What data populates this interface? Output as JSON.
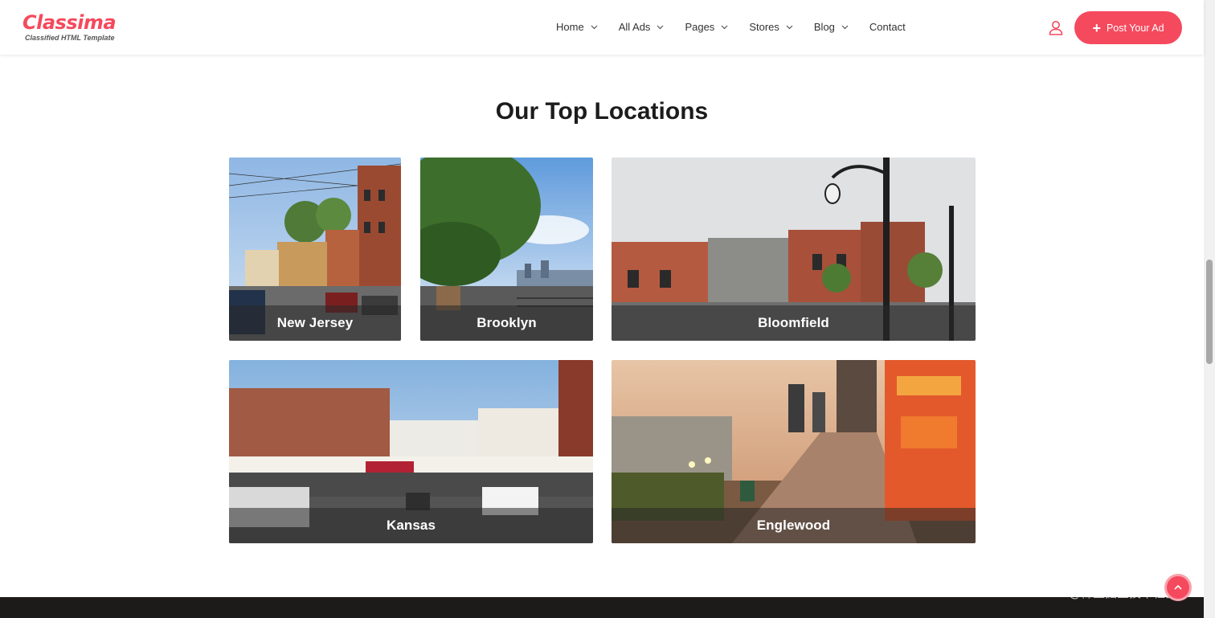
{
  "brand": {
    "name": "Classima",
    "tagline": "Classified HTML Template",
    "accent": "#f5495d"
  },
  "nav": {
    "items": [
      {
        "label": "Home",
        "dropdown": true
      },
      {
        "label": "All Ads",
        "dropdown": true
      },
      {
        "label": "Pages",
        "dropdown": true
      },
      {
        "label": "Stores",
        "dropdown": true
      },
      {
        "label": "Blog",
        "dropdown": true
      },
      {
        "label": "Contact",
        "dropdown": false
      }
    ],
    "post_button": "Post Your Ad",
    "user_icon": "user-icon"
  },
  "section": {
    "title": "Our Top Locations"
  },
  "locations": [
    {
      "name": "New Jersey"
    },
    {
      "name": "Brooklyn"
    },
    {
      "name": "Bloomfield"
    },
    {
      "name": "Kansas"
    },
    {
      "name": "Englewood"
    }
  ],
  "watermark": "@稀土掘金技术社区"
}
